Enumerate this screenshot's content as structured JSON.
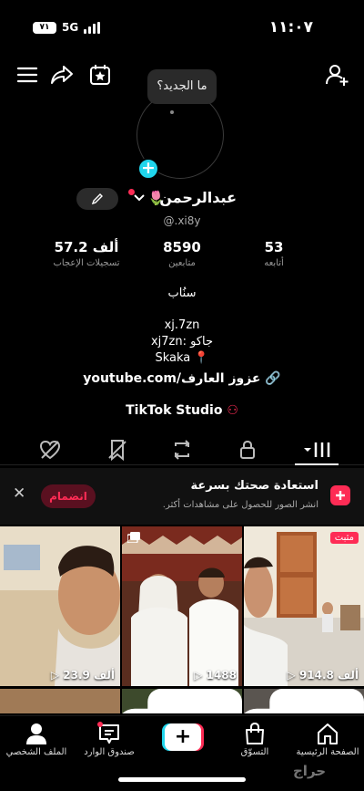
{
  "status_bar": {
    "battery": "٧١",
    "network": "5G",
    "time": "١١:٠٧"
  },
  "profile": {
    "new_bubble": "ما الجديد؟",
    "name": "عبدالرحمن",
    "handle": "@.xi8y",
    "stats": [
      {
        "value": "57.2 ألف",
        "label": "تسجيلات الإعجاب"
      },
      {
        "value": "8590",
        "label": "متابعين"
      },
      {
        "value": "53",
        "label": "أتابعه"
      }
    ],
    "bio": [
      "سنُاب",
      "xj.7zn",
      "جاكو :xj7zn",
      "Skaka 📍"
    ],
    "link": "youtube.com/عزوز العارف",
    "studio": "TikTok Studio"
  },
  "tabs": [
    "videos-grid",
    "private",
    "reposts",
    "favorites-hidden",
    "liked-hidden"
  ],
  "banner": {
    "title": "استعادة صحتك بسرعة",
    "subtitle": "انشر الصور للحصول على مشاهدات أكثر.",
    "join": "انضمام"
  },
  "videos": [
    {
      "views": "23.9 ألف",
      "pinned": ""
    },
    {
      "views": "1488",
      "pinned": ""
    },
    {
      "views": "914.8 ألف",
      "pinned": "مثبت"
    }
  ],
  "nav": {
    "profile": "الملف الشخصي",
    "inbox": "صندوق الوارد",
    "create": "+",
    "shop": "التسوّق",
    "home": "الصفحة الرئيسية"
  },
  "watermark": "حراج"
}
